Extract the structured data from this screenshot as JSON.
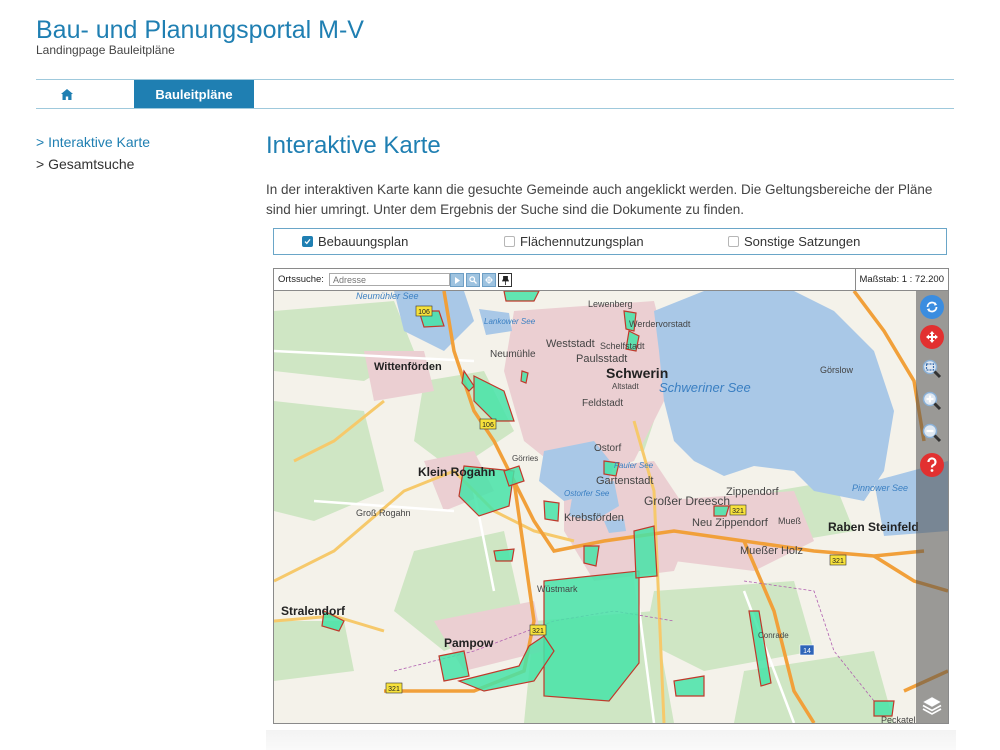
{
  "header": {
    "title": "Bau- und Planungsportal M-V",
    "subtitle": "Landingpage Bauleitpläne"
  },
  "nav": {
    "home_icon": "home-icon",
    "tabs": [
      {
        "label": "Bauleitpläne",
        "active": true
      }
    ]
  },
  "sidebar": {
    "items": [
      {
        "label": "> Interaktive Karte",
        "active": true
      },
      {
        "label": "> Gesamtsuche",
        "active": false
      }
    ]
  },
  "main": {
    "title": "Interaktive Karte",
    "intro": "In der interaktiven Karte kann die gesuchte Gemeinde auch angeklickt werden. Die Geltungsbereiche der Pläne sind hier umringt. Unter dem Ergebnis der Suche sind die Dokumente zu finden."
  },
  "filters": [
    {
      "label": "Bebauungsplan",
      "checked": true
    },
    {
      "label": "Flächennutzungsplan",
      "checked": false
    },
    {
      "label": "Sonstige Satzungen",
      "checked": false
    }
  ],
  "map": {
    "search_label": "Ortssuche:",
    "search_placeholder": "Adresse",
    "scale_label": "Maßstab: 1 : 72.200",
    "places": {
      "neumuehler_see": "Neumühler See",
      "lewenberg": "Lewenberg",
      "lankower_see": "Lankower See",
      "werdervorstadt": "Werdervorstadt",
      "weststadt": "Weststadt",
      "schelfstadt": "Schelfstadt",
      "neumuehle": "Neumühle",
      "paulsstadt": "Paulsstadt",
      "wittenfoerden": "Wittenförden",
      "schwerin": "Schwerin",
      "altstadt": "Altstadt",
      "schweriner_see": "Schweriner See",
      "goerslow": "Görslow",
      "feldstadt": "Feldstadt",
      "ostorf": "Ostorf",
      "goerries": "Görries",
      "fauler_see": "Fauler See",
      "klein_rogahn": "Klein Rogahn",
      "gartenstadt": "Gartenstadt",
      "zippendorf": "Zippendorf",
      "ostorfer_see": "Ostorfer See",
      "grosser_dreesch": "Großer Dreesch",
      "pinnower_see": "Pinnower See",
      "gross_rogahn": "Groß Rogahn",
      "krebsfoerden": "Krebsförden",
      "neu_zippendorf": "Neu Zippendorf",
      "muess": "Mueß",
      "raben_steinfeld": "Raben Steinfeld",
      "muesser_holz": "Mueßer Holz",
      "wuestmark": "Wüstmark",
      "stralendorf": "Stralendorf",
      "conrade": "Conrade",
      "pampow": "Pampow",
      "peckatel": "Peckatel"
    },
    "roads": {
      "r106a": "106",
      "r106b": "106",
      "r321a": "321",
      "r321b": "321",
      "r321c": "321",
      "r321d": "321",
      "a14": "14"
    },
    "controls": [
      "refresh-icon",
      "pan-icon",
      "zoom-extent-icon",
      "zoom-in-icon",
      "zoom-out-icon",
      "help-icon",
      "layers-icon"
    ]
  },
  "colors": {
    "brand": "#1f7fb2",
    "water": "#a9c8e7",
    "urban": "#ebcfd2",
    "forest": "#cfe6c4",
    "plan_fill": "#46e3a8",
    "plan_stroke": "#c0392b",
    "road_major": "#f1a03a"
  }
}
